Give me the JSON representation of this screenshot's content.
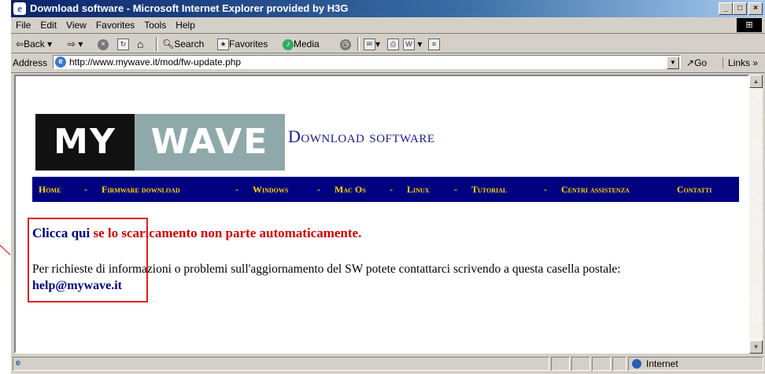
{
  "window": {
    "title": "Download software - Microsoft Internet Explorer provided by H3G"
  },
  "menu": [
    "File",
    "Edit",
    "View",
    "Favorites",
    "Tools",
    "Help"
  ],
  "toolbar": {
    "back": "Back",
    "search": "Search",
    "favorites": "Favorites",
    "media": "Media"
  },
  "address": {
    "label": "Address",
    "url": "http://www.mywave.it/mod/fw-update.php",
    "go": "Go",
    "links": "Links"
  },
  "page": {
    "logo_left": "MY",
    "logo_right": "WAVE",
    "title": "Download software",
    "nav": [
      "Home",
      "Firmware download",
      "Windows",
      "Mac Os",
      "Linux",
      "Tutorial",
      "Centri assistenza",
      "Contatti"
    ],
    "nav_separator": "-",
    "link_text": "Clicca qui",
    "link_rest": "se lo scaricamento non parte automaticamente.",
    "info": "Per richieste di informazioni o problemi sull'aggiornamento del SW potete contattarci scrivendo a questa casella postale:",
    "email": "help@mywave.it"
  },
  "status": {
    "zone": "Internet"
  }
}
